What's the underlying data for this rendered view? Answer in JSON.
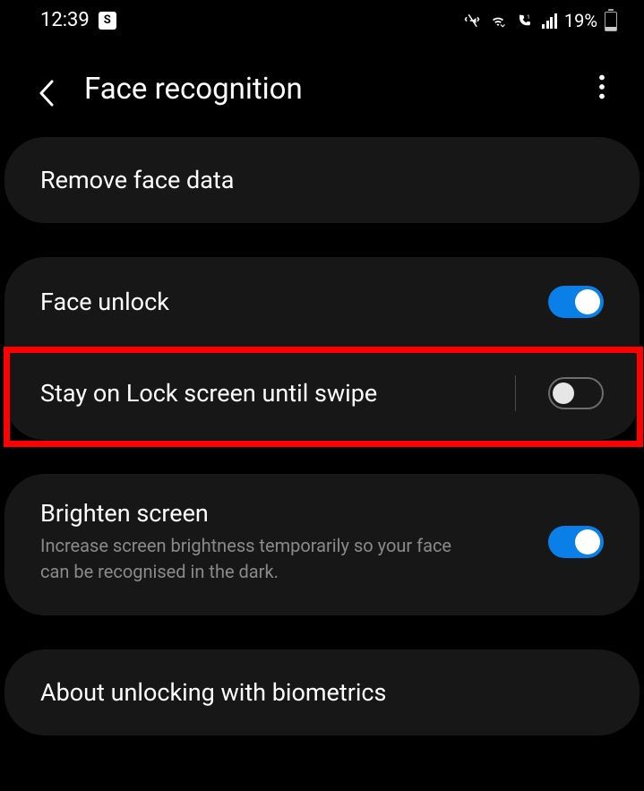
{
  "status": {
    "time": "12:39",
    "app_indicator": "S",
    "battery_percent": "19%"
  },
  "header": {
    "title": "Face recognition"
  },
  "rows": {
    "remove": {
      "label": "Remove face data"
    },
    "face_unlock": {
      "label": "Face unlock",
      "enabled": true
    },
    "stay_lock": {
      "label": "Stay on Lock screen until swipe",
      "enabled": false
    },
    "brighten": {
      "label": "Brighten screen",
      "sub": "Increase screen brightness temporarily so your face can be recognised in the dark.",
      "enabled": true
    },
    "about": {
      "label": "About unlocking with biometrics"
    }
  },
  "highlight": {
    "target": "stay_lock"
  }
}
